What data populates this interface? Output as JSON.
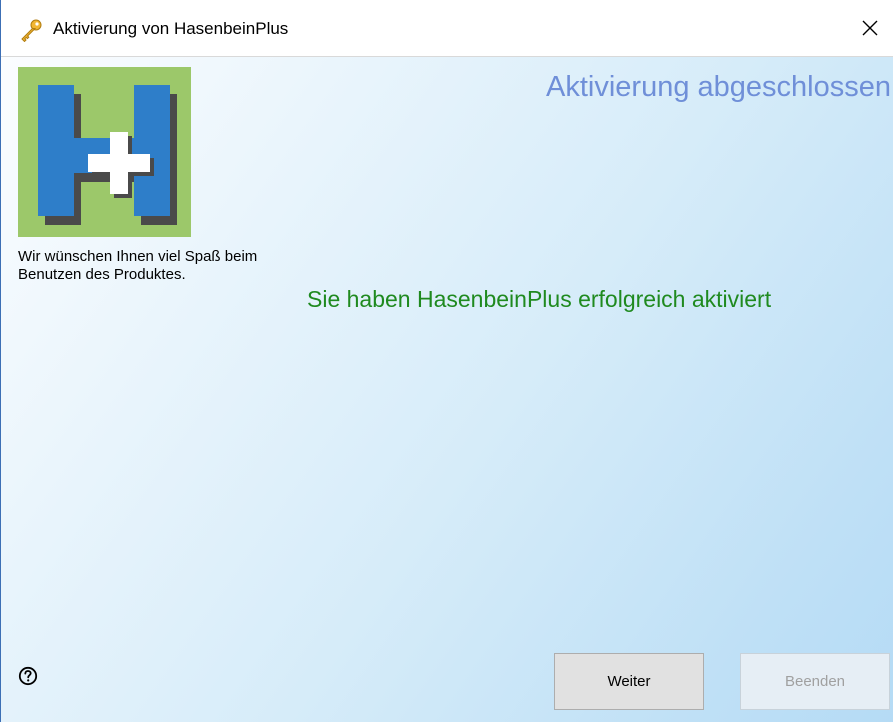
{
  "window": {
    "title": "Aktivierung von HasenbeinPlus",
    "close_glyph": "✕"
  },
  "sidebar": {
    "welcome_text": "Wir wünschen Ihnen viel Spaß beim Benutzen des Produktes."
  },
  "main": {
    "heading": "Aktivierung abgeschlossen",
    "success_message": "Sie haben HasenbeinPlus erfolgreich aktiviert"
  },
  "buttons": {
    "next_label": "Weiter",
    "finish_label": "Beenden",
    "finish_enabled": false
  },
  "icons": {
    "title": "key-icon",
    "logo": "hasenbeinplus-logo",
    "help": "help-icon",
    "close": "close-icon"
  },
  "colors": {
    "heading": "#6f8fd8",
    "success": "#1f8a1f",
    "logo_background": "#9cc86a",
    "logo_letter": "#2e7ec9"
  }
}
